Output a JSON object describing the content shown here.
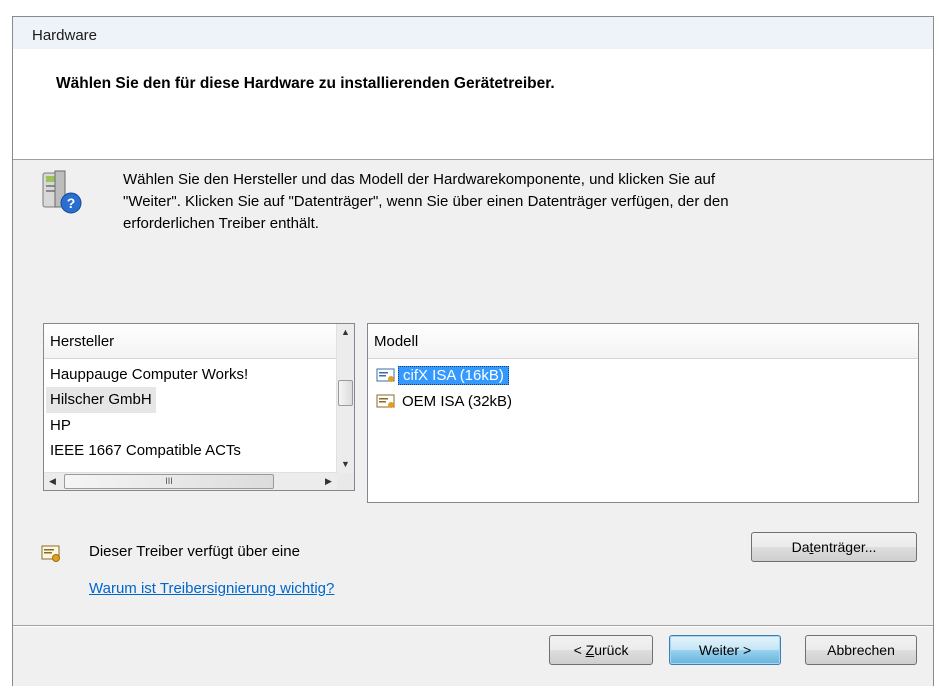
{
  "window": {
    "title": "Hardware"
  },
  "header": {
    "heading": "Wählen Sie den für diese Hardware zu installierenden Gerätetreiber."
  },
  "intro": {
    "icon": "hardware-question-icon",
    "line1": "Wählen Sie den Hersteller und das Modell der Hardwarekomponente, und klicken Sie auf",
    "line2": "\"Weiter\". Klicken Sie auf \"Datenträger\", wenn Sie über einen Datenträger verfügen, der den",
    "line3": "erforderlichen Treiber enthält."
  },
  "manufacturers": {
    "header": "Hersteller",
    "items": [
      {
        "label": "Hauppauge Computer Works!"
      },
      {
        "label": "Hilscher GmbH",
        "selected": true
      },
      {
        "label": "HP"
      },
      {
        "label": "IEEE 1667 Compatible ACTs"
      }
    ],
    "hscroll_grip": "III"
  },
  "models": {
    "header": "Modell",
    "items": [
      {
        "label": "cifX ISA (16kB)",
        "selected": true,
        "icon": "signed-driver-icon"
      },
      {
        "label": "OEM ISA (32kB)",
        "selected": false,
        "icon": "signed-driver-icon"
      }
    ]
  },
  "signature": {
    "icon": "signed-driver-icon",
    "text": "Dieser Treiber verfügt über eine",
    "link": "Warum ist Treibersignierung wichtig?"
  },
  "buttons": {
    "disk_prefix": "Da",
    "disk_underline": "t",
    "disk_suffix": "enträger...",
    "back_prefix": "< ",
    "back_underline": "Z",
    "back_suffix": "urück",
    "next": "Weiter >",
    "cancel": "Abbrechen"
  },
  "colors": {
    "selection": "#3399ff",
    "link": "#0066cc",
    "header_bg": "#ffffff",
    "dialog_bg": "#f0f0f0"
  }
}
